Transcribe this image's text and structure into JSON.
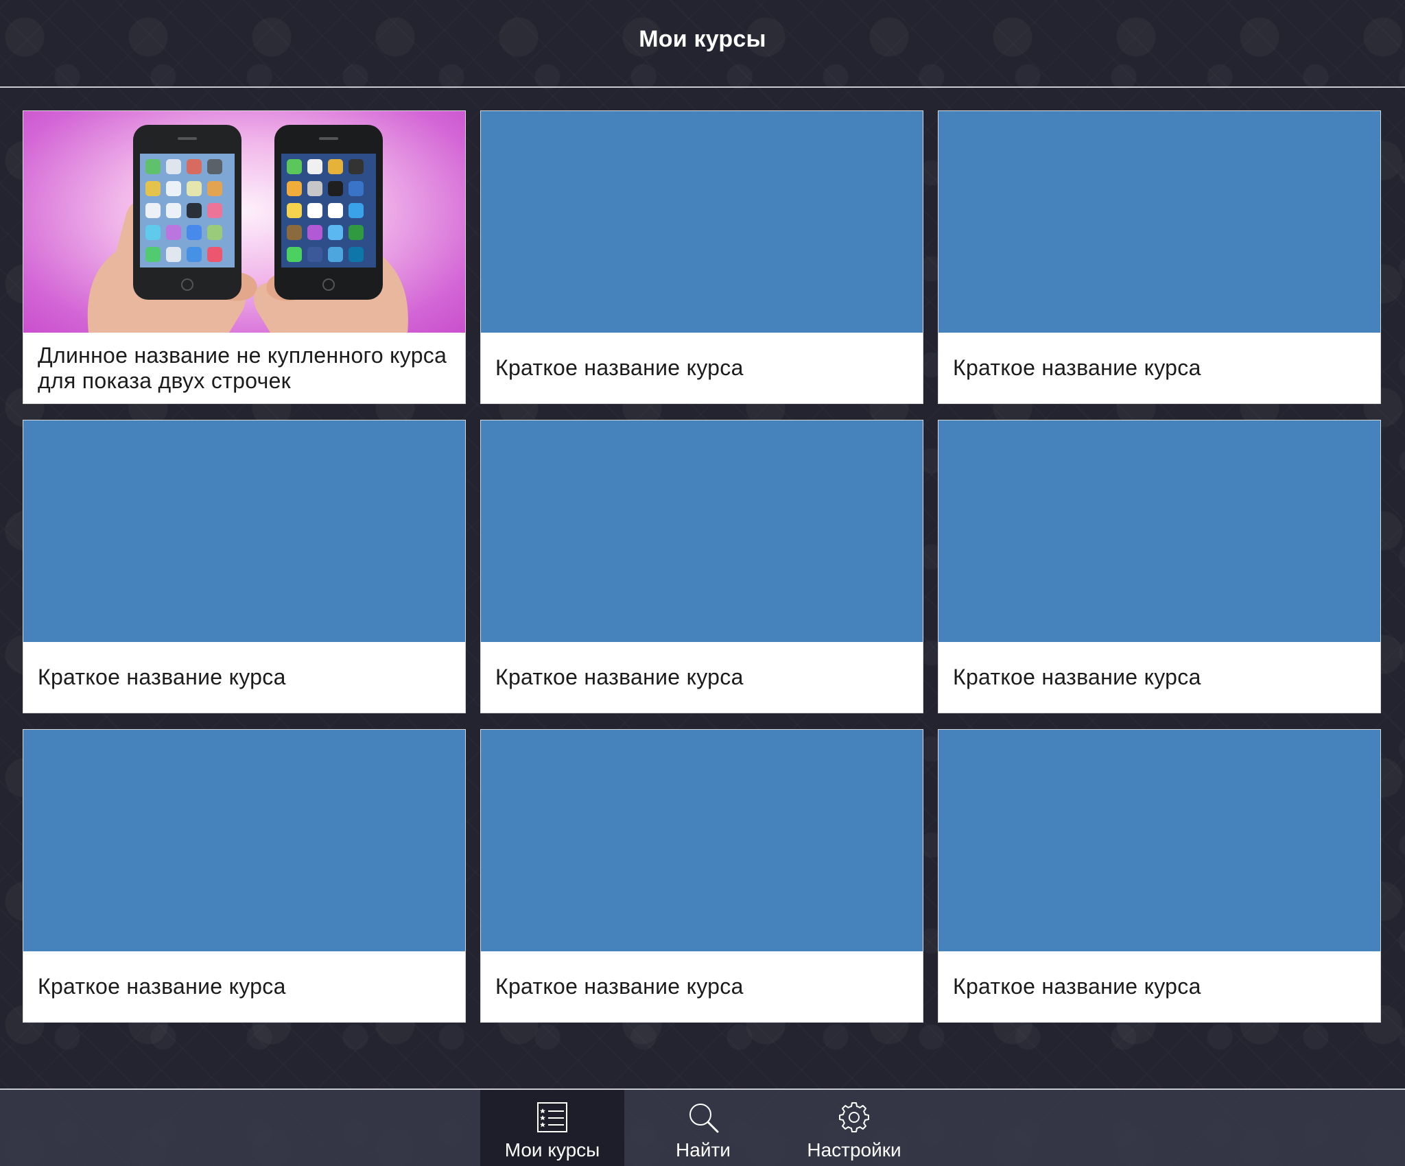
{
  "navbar": {
    "title": "Мои курсы"
  },
  "courses": [
    {
      "title": "Длинное название не купленного курса для показа двух строчек",
      "cover": "phones-image"
    },
    {
      "title": "Краткое название курса",
      "cover": "placeholder"
    },
    {
      "title": "Краткое название курса",
      "cover": "placeholder"
    },
    {
      "title": "Краткое название курса",
      "cover": "placeholder"
    },
    {
      "title": "Краткое название курса",
      "cover": "placeholder"
    },
    {
      "title": "Краткое название курса",
      "cover": "placeholder"
    },
    {
      "title": "Краткое название курса",
      "cover": "placeholder"
    },
    {
      "title": "Краткое название курса",
      "cover": "placeholder"
    },
    {
      "title": "Краткое название курса",
      "cover": "placeholder"
    }
  ],
  "tabbar": {
    "tabs": [
      {
        "label": "Мои курсы",
        "icon": "list-icon",
        "active": true
      },
      {
        "label": "Найти",
        "icon": "search-icon",
        "active": false
      },
      {
        "label": "Настройки",
        "icon": "gear-icon",
        "active": false
      }
    ]
  },
  "colors": {
    "background": "#23242f",
    "cover_placeholder": "#4682bc",
    "card": "#ffffff",
    "tabbar": "#363848",
    "tab_active": "#1d1e29"
  }
}
